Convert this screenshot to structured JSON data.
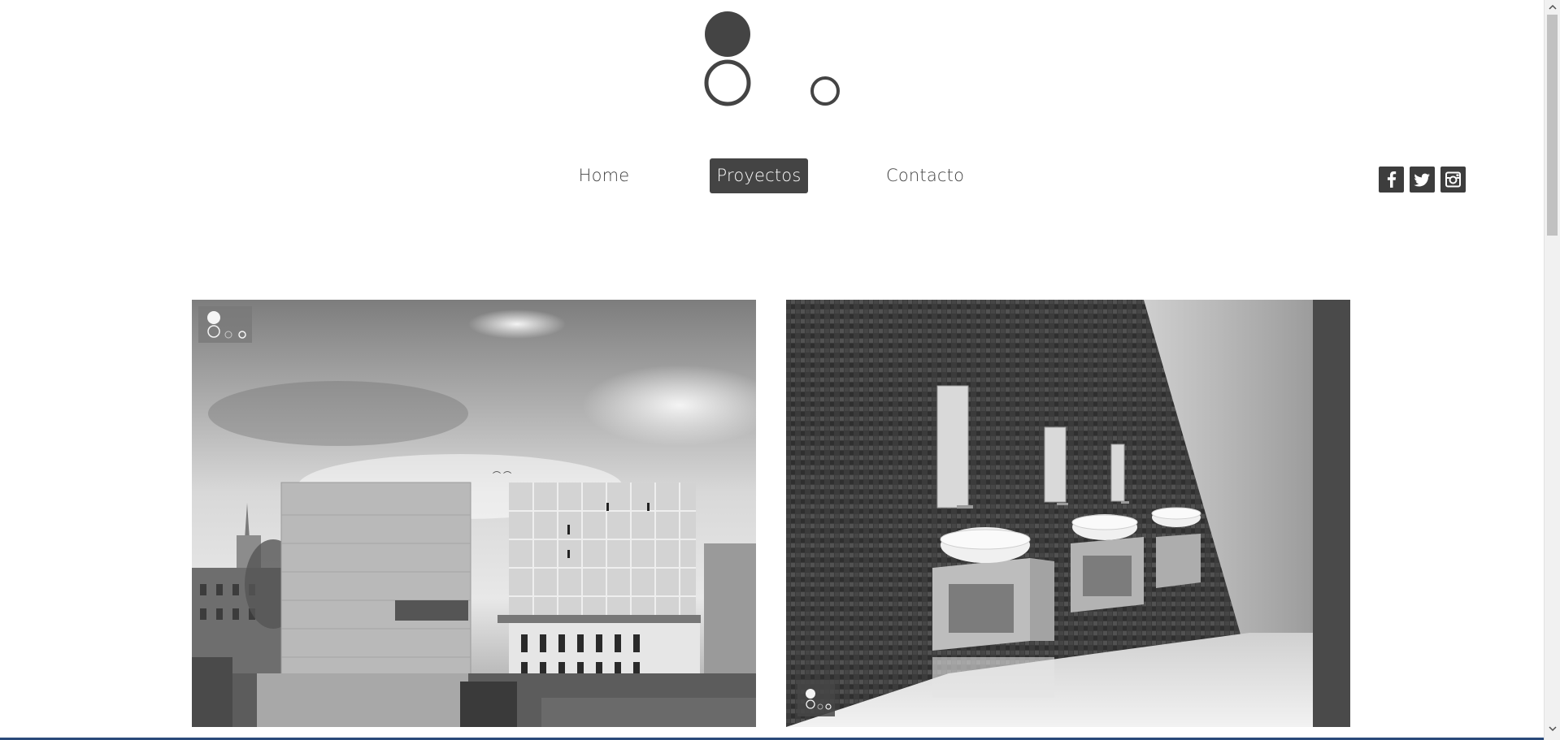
{
  "nav": {
    "items": [
      {
        "label": "Home",
        "active": false
      },
      {
        "label": "Proyectos",
        "active": true
      },
      {
        "label": "Contacto",
        "active": false
      }
    ]
  },
  "social": [
    {
      "icon": "facebook-icon",
      "glyph": "f"
    },
    {
      "icon": "twitter-icon",
      "glyph": "t"
    },
    {
      "icon": "instagram-icon",
      "glyph": "i"
    }
  ],
  "projects": [
    {
      "image": "architecture-building-render",
      "tone": "grayscale"
    },
    {
      "image": "bathroom-sinks-render",
      "tone": "grayscale"
    }
  ],
  "colors": {
    "accent": "#444444",
    "social_bg": "#3d3d3d",
    "background": "#ffffff"
  }
}
